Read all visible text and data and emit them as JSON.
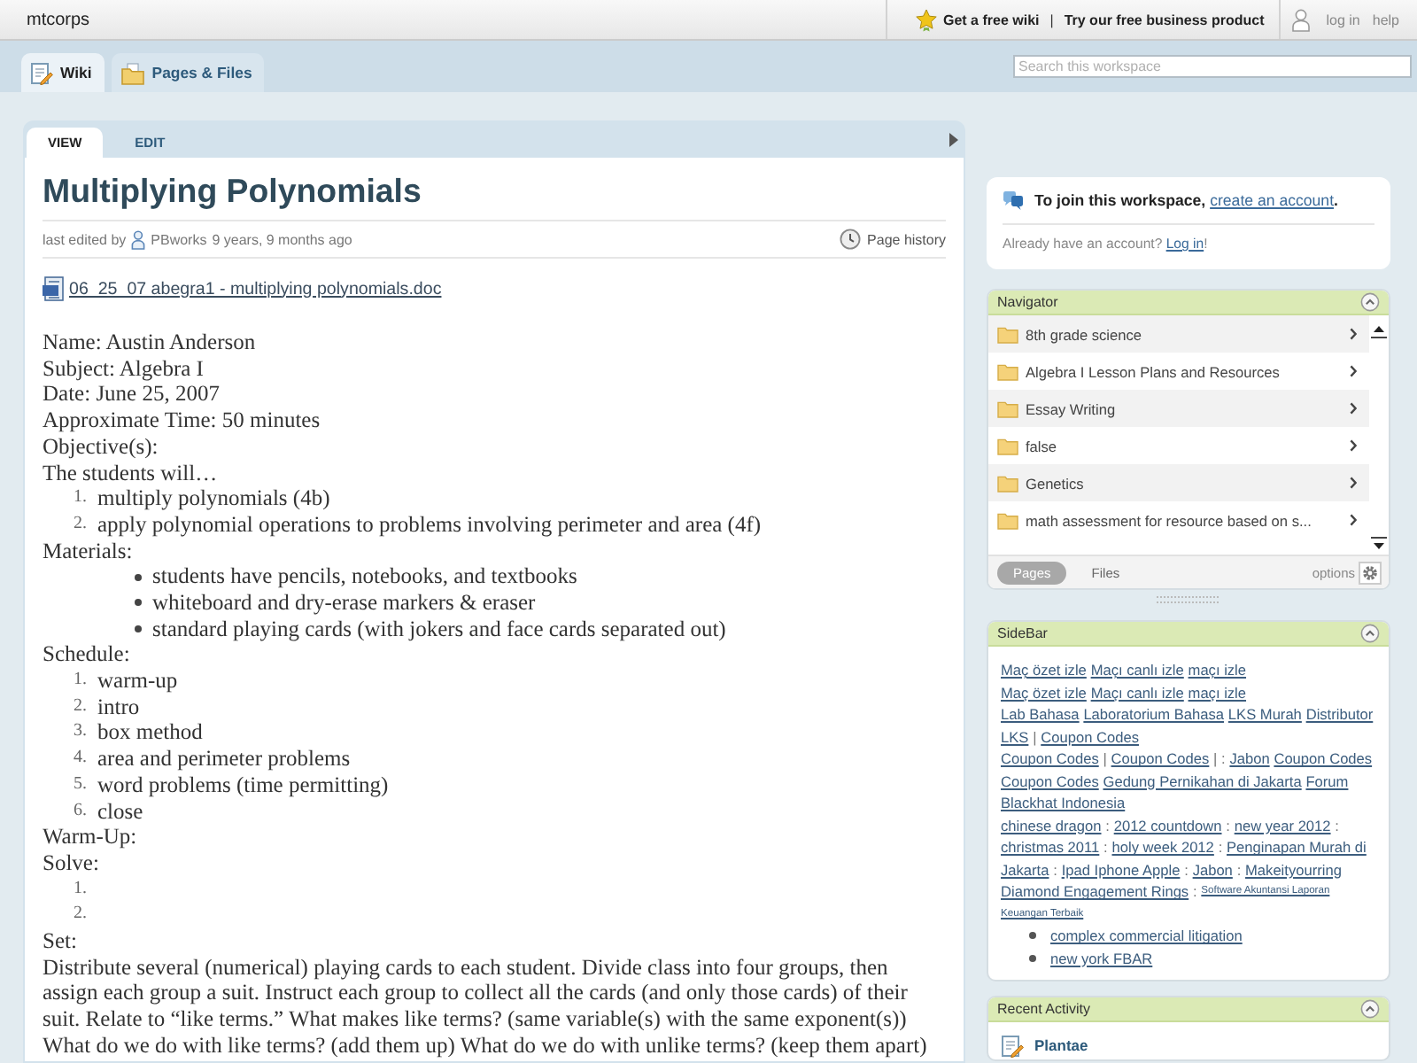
{
  "top_bar": {
    "site_name": "mtcorps",
    "promo_links": [
      "Get a free wiki",
      "Try our free business product"
    ],
    "separator": "|",
    "account_links": [
      "log in",
      "help"
    ]
  },
  "nav_tabs": [
    {
      "label": "Wiki",
      "selected": true
    },
    {
      "label": "Pages & Files",
      "selected": false
    }
  ],
  "search": {
    "placeholder": "Search this workspace"
  },
  "page": {
    "tabs": [
      {
        "label": "VIEW",
        "selected": true
      },
      {
        "label": "EDIT",
        "selected": false
      }
    ],
    "title": "Multiplying Polynomials",
    "last_edited": {
      "prefix": "last edited by",
      "author": "PBworks",
      "age": "9 years, 9 months ago"
    },
    "history_link": "Page history",
    "attachment": "06_25_07 abegra1 - multiplying polynomials.doc",
    "blocks": [
      {
        "kind": "text",
        "text": "Name: Austin Anderson"
      },
      {
        "kind": "text",
        "text": "Subject: Algebra I"
      },
      {
        "kind": "text",
        "text": "Date: June 25, 2007"
      },
      {
        "kind": "text",
        "text": "Approximate Time: 50 minutes"
      },
      {
        "kind": "text",
        "text": "Objective(s):"
      },
      {
        "kind": "text",
        "text": "The students will…"
      },
      {
        "kind": "numbered",
        "items": [
          {
            "number": "1.",
            "text": "multiply polynomials (4b)"
          },
          {
            "number": "2.",
            "text": "apply polynomial operations to problems involving perimeter and area (4f)"
          }
        ]
      },
      {
        "kind": "text",
        "text": "Materials:"
      },
      {
        "kind": "bulleted",
        "items": [
          "students have pencils, notebooks, and textbooks",
          "whiteboard and dry-erase markers & eraser",
          "standard playing cards (with jokers and face cards separated out)"
        ]
      },
      {
        "kind": "text",
        "text": "Schedule:"
      },
      {
        "kind": "numbered",
        "items": [
          {
            "number": "1.",
            "text": "warm-up"
          },
          {
            "number": "2.",
            "text": "intro"
          },
          {
            "number": "3.",
            "text": "box method"
          },
          {
            "number": "4.",
            "text": "area and perimeter problems"
          },
          {
            "number": "5.",
            "text": "word problems (time permitting)"
          },
          {
            "number": "6.",
            "text": "close"
          }
        ]
      },
      {
        "kind": "text",
        "text": "Warm-Up:"
      },
      {
        "kind": "text",
        "text": "Solve:"
      },
      {
        "kind": "numbered",
        "items": [
          {
            "number": "1."
          },
          {
            "number": "2."
          }
        ]
      },
      {
        "kind": "text",
        "text": "Set:"
      },
      {
        "kind": "text",
        "text": "Distribute several (numerical) playing cards to each student. Divide class into four groups, then assign each group a suit. Instruct each group to collect all the cards (and only those cards) of their suit. Relate to “like terms.” What makes like terms? (same variable(s) with the same exponent(s)) What do we do with like terms? (add them up) What do we do with unlike terms? (keep them apart)"
      }
    ]
  },
  "join": {
    "prompt": "To join this workspace,",
    "link": "create an account",
    "end": ".",
    "login_prompt": "Already have an account?",
    "login_link": "Log in",
    "login_end": "!"
  },
  "navigator": {
    "title": "Navigator",
    "items": [
      "8th grade science",
      "Algebra I Lesson Plans and Resources",
      "Essay Writing",
      "false",
      "Genetics",
      "math assessment for resource based on s..."
    ],
    "tabs": [
      {
        "label": "Pages",
        "selected": true
      },
      {
        "label": "Files",
        "selected": false
      }
    ],
    "options": "options"
  },
  "sidebar": {
    "title": "SideBar",
    "lines": [
      [
        {
          "kind": "link",
          "text": "Maç özet izle"
        },
        {
          "kind": "link",
          "text": "Maçı canlı izle"
        },
        {
          "kind": "link",
          "text": "maçı izle"
        }
      ],
      [
        {
          "kind": "link",
          "text": "Maç özet izle"
        },
        {
          "kind": "link",
          "text": "Maçı canlı izle"
        },
        {
          "kind": "link",
          "text": "maçı izle"
        }
      ],
      [
        {
          "kind": "link",
          "text": "Lab Bahasa"
        },
        {
          "kind": "link",
          "text": "Laboratorium Bahasa"
        },
        {
          "kind": "link",
          "text": "LKS Murah"
        },
        {
          "kind": "link",
          "text": "Distributor"
        }
      ],
      [
        {
          "kind": "link",
          "text": "LKS"
        },
        {
          "kind": "text",
          "text": "|"
        },
        {
          "kind": "link",
          "text": "Coupon Codes"
        }
      ],
      [
        {
          "kind": "link",
          "text": "Coupon Codes"
        },
        {
          "kind": "text",
          "text": "|"
        },
        {
          "kind": "link",
          "text": "Coupon Codes"
        },
        {
          "kind": "text",
          "text": "| :"
        },
        {
          "kind": "link",
          "text": "Jabon"
        },
        {
          "kind": "link",
          "text": "Coupon Codes"
        }
      ],
      [
        {
          "kind": "link",
          "text": "Coupon Codes"
        },
        {
          "kind": "link",
          "text": "Gedung Pernikahan di Jakarta"
        },
        {
          "kind": "link",
          "text": "Forum"
        }
      ],
      [
        {
          "kind": "link",
          "text": "Blackhat Indonesia"
        }
      ],
      [
        {
          "kind": "link",
          "text": "chinese dragon"
        },
        {
          "kind": "text",
          "text": ":"
        },
        {
          "kind": "link",
          "text": "2012 countdown"
        },
        {
          "kind": "text",
          "text": ":"
        },
        {
          "kind": "link",
          "text": "new year 2012"
        },
        {
          "kind": "text",
          "text": ":"
        }
      ],
      [
        {
          "kind": "link",
          "text": "christmas 2011"
        },
        {
          "kind": "text",
          "text": ":"
        },
        {
          "kind": "link",
          "text": "holy week 2012"
        },
        {
          "kind": "text",
          "text": ":"
        },
        {
          "kind": "link",
          "text": "Penginapan Murah di"
        }
      ],
      [
        {
          "kind": "link",
          "text": "Jakarta"
        },
        {
          "kind": "text",
          "text": ":"
        },
        {
          "kind": "link",
          "text": "Ipad Iphone Apple"
        },
        {
          "kind": "text",
          "text": ":"
        },
        {
          "kind": "link",
          "text": "Jabon"
        },
        {
          "kind": "text",
          "text": ":"
        },
        {
          "kind": "link",
          "text": "Makeityourring"
        }
      ],
      [
        {
          "kind": "link",
          "text": "Diamond Engagement Rings"
        },
        {
          "kind": "text",
          "text": ":"
        },
        {
          "kind": "small_link",
          "text": "Software Akuntansi Laporan"
        }
      ],
      [
        {
          "kind": "small_link",
          "text": "Keuangan Terbaik"
        }
      ]
    ],
    "bullets": [
      "complex commercial litigation",
      "new york FBAR"
    ]
  },
  "recent_activity": {
    "title": "Recent Activity",
    "items": [
      {
        "title": "Plantae"
      }
    ]
  }
}
